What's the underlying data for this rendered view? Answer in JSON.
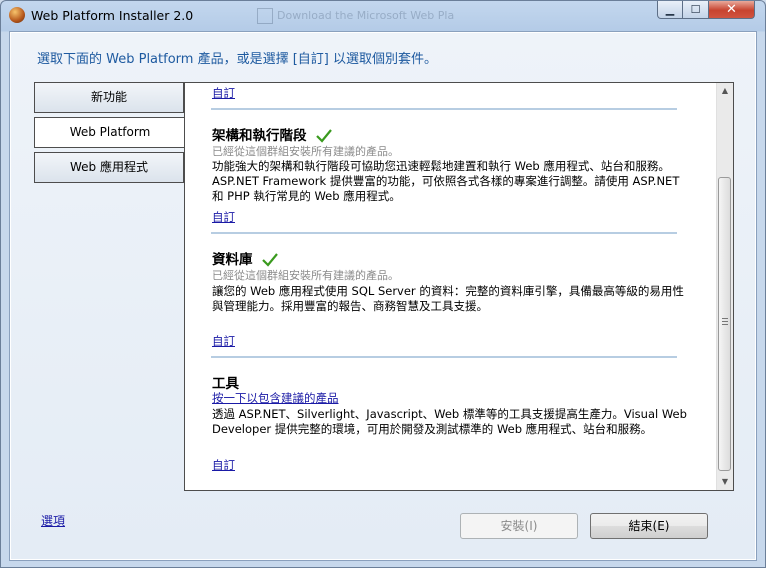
{
  "window": {
    "title": "Web Platform Installer 2.0",
    "background_ghost": "Download the Microsoft Web Pla"
  },
  "instruction": "選取下面的 Web Platform 產品，或是選擇 [自訂] 以選取個別套件。",
  "tabs": [
    {
      "label": "新功能",
      "active": false
    },
    {
      "label": "Web Platform",
      "active": true
    },
    {
      "label": "Web 應用程式",
      "active": false
    }
  ],
  "top_custom_link": "自訂",
  "sections": [
    {
      "title": "架構和執行階段",
      "subtitle": "已經從這個群組安裝所有建議的產品。",
      "desc1": "功能強大的架構和執行階段可協助您迅速輕鬆地建置和執行 Web 應用程式、站台和服務。",
      "desc2": "ASP.NET Framework 提供豐富的功能，可依照各式各樣的專案進行調整。請使用 ASP.NET",
      "desc3": "和 PHP 執行常見的 Web 應用程式。",
      "link": "自訂"
    },
    {
      "title": "資料庫",
      "subtitle": "已經從這個群組安裝所有建議的產品。",
      "desc1": "讓您的 Web 應用程式使用 SQL Server 的資料：完整的資料庫引擎，具備最高等級的易用性",
      "desc2": "與管理能力。採用豐富的報告、商務智慧及工具支援。",
      "link": "自訂"
    },
    {
      "title": "工具",
      "subtitle_link": "按一下以包含建議的產品",
      "desc1": "透過 ASP.NET、Silverlight、Javascript、Web 標準等的工具支援提高生產力。Visual Web",
      "desc2": "Developer 提供完整的環境，可用於開發及測試標準的 Web 應用程式、站台和服務。",
      "link": "自訂"
    }
  ],
  "footer": {
    "options_link": "選項",
    "install_button": "安裝(I)",
    "finish_button": "結束(E)"
  },
  "colors": {
    "accent_text": "#1e5aa0",
    "link": "#1a1aa6",
    "check": "#3a9a1e"
  }
}
